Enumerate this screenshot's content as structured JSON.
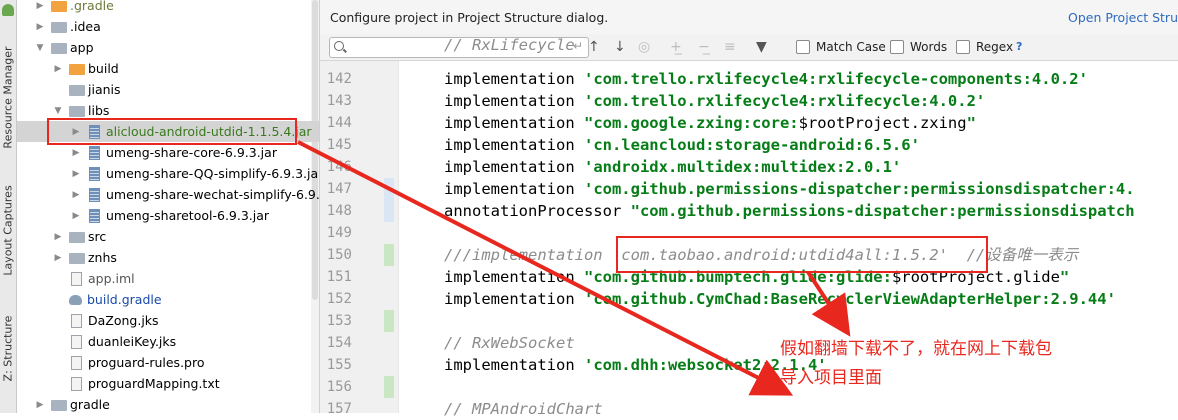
{
  "sidebar": {
    "tabs": [
      "Resource Manager",
      "Layout Captures",
      "Z: Structure"
    ]
  },
  "tree": {
    "items": [
      {
        "label": ".gradle",
        "type": "folder-orange",
        "arrow": "▶",
        "indent": 1,
        "color": "olive"
      },
      {
        "label": ".idea",
        "type": "folder",
        "arrow": "▶",
        "indent": 1,
        "color": "normal"
      },
      {
        "label": "app",
        "type": "folder",
        "arrow": "▼",
        "indent": 1,
        "color": "normal"
      },
      {
        "label": "build",
        "type": "folder-orange",
        "arrow": "▶",
        "indent": 2,
        "color": "normal"
      },
      {
        "label": "jianis",
        "type": "folder",
        "arrow": "",
        "indent": 2,
        "color": "normal"
      },
      {
        "label": "libs",
        "type": "folder",
        "arrow": "▼",
        "indent": 2,
        "color": "normal"
      },
      {
        "label": "alicloud-android-utdid-1.1.5.4.jar",
        "type": "jar",
        "arrow": "▶",
        "indent": 3,
        "color": "green",
        "selected": true
      },
      {
        "label": "umeng-share-core-6.9.3.jar",
        "type": "jar",
        "arrow": "▶",
        "indent": 3,
        "color": "normal"
      },
      {
        "label": "umeng-share-QQ-simplify-6.9.3.jar",
        "type": "jar",
        "arrow": "▶",
        "indent": 3,
        "color": "normal"
      },
      {
        "label": "umeng-share-wechat-simplify-6.9.3.jar",
        "type": "jar",
        "arrow": "▶",
        "indent": 3,
        "color": "normal"
      },
      {
        "label": "umeng-sharetool-6.9.3.jar",
        "type": "jar",
        "arrow": "▶",
        "indent": 3,
        "color": "normal"
      },
      {
        "label": "src",
        "type": "folder",
        "arrow": "▶",
        "indent": 2,
        "color": "normal"
      },
      {
        "label": "znhs",
        "type": "folder",
        "arrow": "▶",
        "indent": 2,
        "color": "normal"
      },
      {
        "label": "app.iml",
        "type": "file",
        "arrow": "",
        "indent": 2,
        "color": "gray"
      },
      {
        "label": "build.gradle",
        "type": "gradle",
        "arrow": "",
        "indent": 2,
        "color": "blue"
      },
      {
        "label": "DaZong.jks",
        "type": "file",
        "arrow": "",
        "indent": 2,
        "color": "normal"
      },
      {
        "label": "duanleiKey.jks",
        "type": "file",
        "arrow": "",
        "indent": 2,
        "color": "normal"
      },
      {
        "label": "proguard-rules.pro",
        "type": "file",
        "arrow": "",
        "indent": 2,
        "color": "normal"
      },
      {
        "label": "proguardMapping.txt",
        "type": "file",
        "arrow": "",
        "indent": 2,
        "color": "normal"
      },
      {
        "label": "gradle",
        "type": "folder",
        "arrow": "▶",
        "indent": 1,
        "color": "normal"
      }
    ]
  },
  "banner": {
    "text": "Configure project in Project Structure dialog.",
    "link": "Open Project Stru"
  },
  "find": {
    "value": "",
    "match_case": "Match Case",
    "words": "Words",
    "regex": "Regex",
    "help": "?"
  },
  "editor": {
    "lines": [
      {
        "num": "142",
        "parts": [
          [
            "k",
            "implementation "
          ],
          [
            "s",
            "'com.trello.rxlifecycle4:rxlifecycle-components:4.0.2'"
          ]
        ],
        "change": ""
      },
      {
        "num": "143",
        "parts": [
          [
            "k",
            "implementation "
          ],
          [
            "s",
            "'com.trello.rxlifecycle4:rxlifecycle:4.0.2'"
          ]
        ],
        "change": ""
      },
      {
        "num": "144",
        "parts": [
          [
            "k",
            "implementation "
          ],
          [
            "s",
            "\"com.google.zxing:core:"
          ],
          [
            "k",
            "$rootProject.zxing"
          ],
          [
            "s",
            "\""
          ]
        ],
        "change": ""
      },
      {
        "num": "145",
        "parts": [
          [
            "k",
            "implementation "
          ],
          [
            "s",
            "'cn.leancloud:storage-android:6.5.6'"
          ]
        ],
        "change": ""
      },
      {
        "num": "146",
        "parts": [
          [
            "k",
            "implementation "
          ],
          [
            "s",
            "'androidx.multidex:multidex:2.0.1'"
          ]
        ],
        "change": ""
      },
      {
        "num": "147",
        "parts": [
          [
            "k",
            "implementation "
          ],
          [
            "s",
            "'com.github.permissions-dispatcher:permissionsdispatcher:4."
          ]
        ],
        "change": "#dbe6f5"
      },
      {
        "num": "148",
        "parts": [
          [
            "k",
            "annotationProcessor "
          ],
          [
            "s",
            "\"com.github.permissions-dispatcher:permissionsdispatch"
          ]
        ],
        "change": "#dbe6f5"
      },
      {
        "num": "149",
        "parts": [
          [
            "k",
            ""
          ]
        ],
        "change": ""
      },
      {
        "num": "150",
        "parts": [
          [
            "c",
            "///implementation 'com.taobao.android:utdid4all:1.5.2'  //设备唯一表示"
          ]
        ],
        "change": "#c9e7c2"
      },
      {
        "num": "151",
        "parts": [
          [
            "k",
            "implementation "
          ],
          [
            "s",
            "\"com.github.bumptech.glide:glide:"
          ],
          [
            "k",
            "$rootProject.glide"
          ],
          [
            "s",
            "\""
          ]
        ],
        "change": ""
      },
      {
        "num": "152",
        "parts": [
          [
            "k",
            "implementation "
          ],
          [
            "s",
            "'com.github.CymChad:BaseRecyclerViewAdapterHelper:2.9.44'"
          ]
        ],
        "change": ""
      },
      {
        "num": "153",
        "parts": [
          [
            "k",
            ""
          ]
        ],
        "change": "#c9e7c2"
      },
      {
        "num": "154",
        "parts": [
          [
            "c",
            "// RxWebSocket"
          ]
        ],
        "change": ""
      },
      {
        "num": "155",
        "parts": [
          [
            "k",
            "implementation "
          ],
          [
            "s",
            "'com.dhh:websocket2:2.1.4'"
          ]
        ],
        "change": ""
      },
      {
        "num": "156",
        "parts": [
          [
            "k",
            ""
          ]
        ],
        "change": "#c9e7c2"
      },
      {
        "num": "157",
        "parts": [
          [
            "c",
            "// MPAndroidChart"
          ]
        ],
        "change": ""
      }
    ],
    "top_partial": "// RxLifecycle"
  },
  "annotation": {
    "line1": "假如翻墙下载不了，就在网上下载包",
    "line2": "导入项目里面",
    "color": "#e8281f"
  }
}
